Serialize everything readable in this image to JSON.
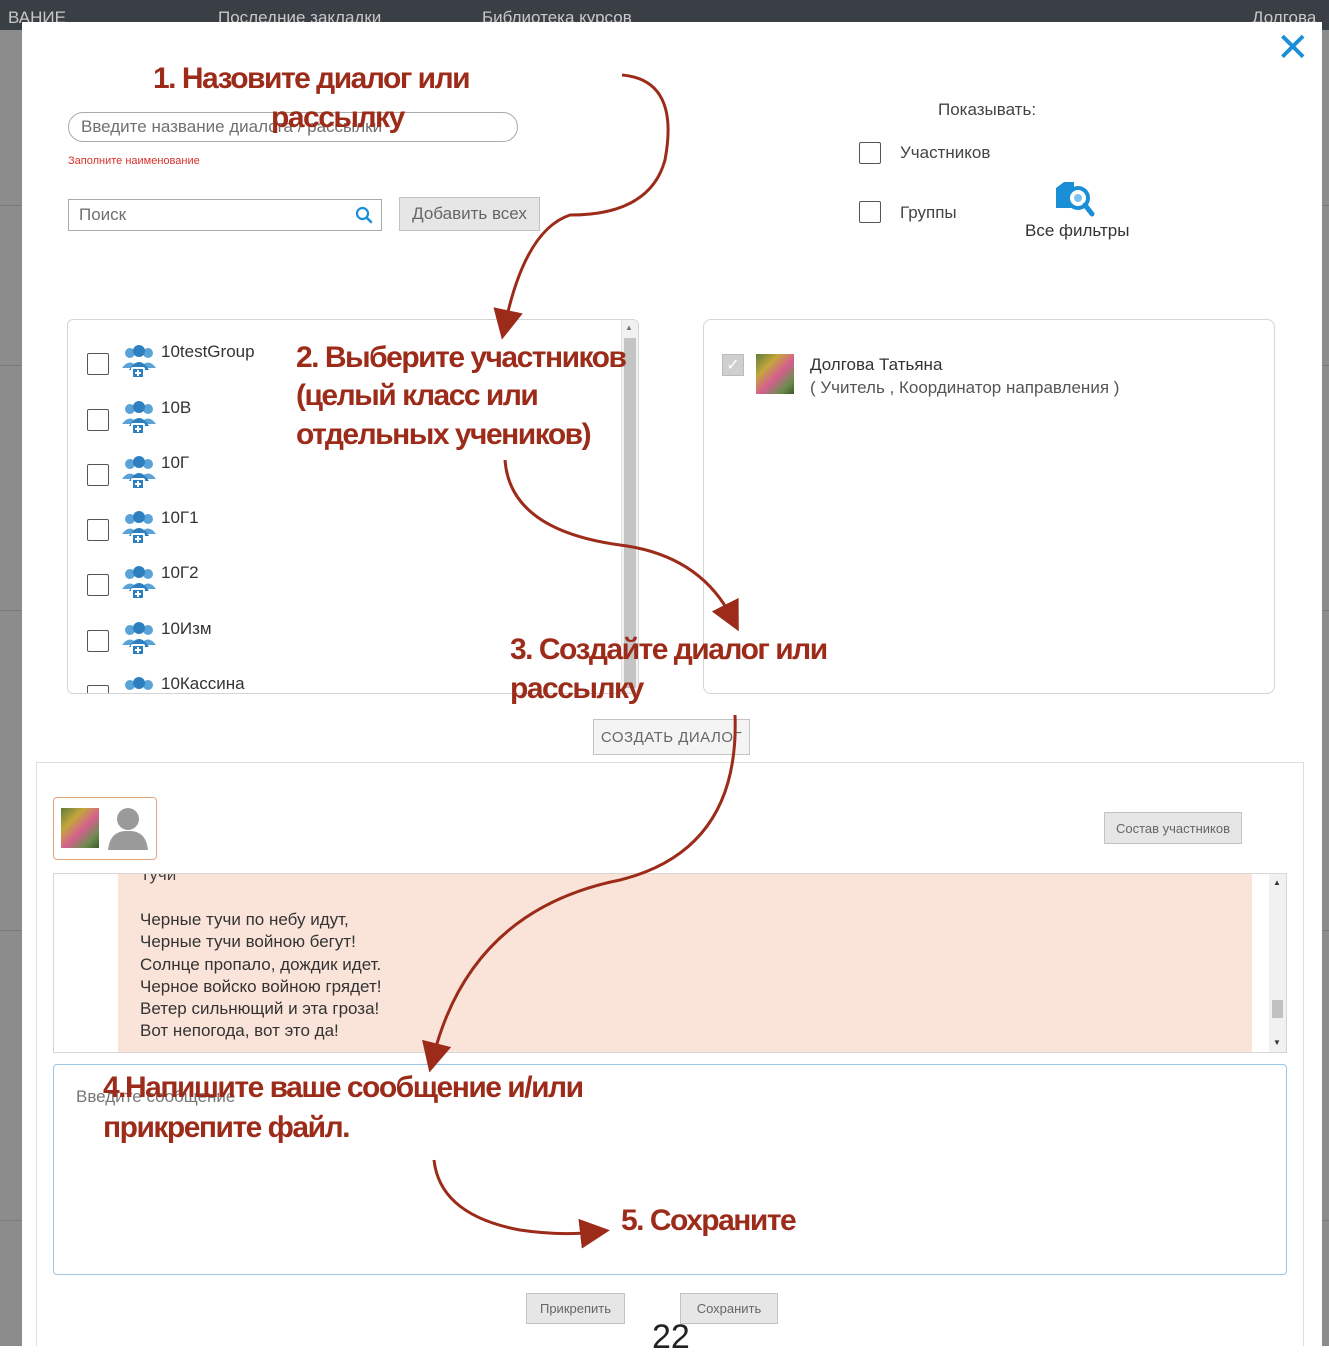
{
  "background": {
    "nav_item_1": "Последние закладки",
    "nav_item_2": "Библиотека курсов",
    "left_fragment": "ВАНИЕ",
    "user_fragment": "Долгова"
  },
  "dialog": {
    "close_icon": "close-icon",
    "name_placeholder": "Введите название диалога / рассылки",
    "name_error": "Заполните наименование",
    "search_placeholder": "Поиск",
    "add_all_label": "Добавить всех",
    "show_label": "Показывать:",
    "filter_participants_label": "Участников",
    "filter_groups_label": "Группы",
    "all_filters_label": "Все фильтры",
    "groups": [
      {
        "label": "10testGroup"
      },
      {
        "label": "10В"
      },
      {
        "label": "10Г"
      },
      {
        "label": "10Г1"
      },
      {
        "label": "10Г2"
      },
      {
        "label": "10Изм"
      },
      {
        "label": "10Кассина"
      }
    ],
    "selected_member": {
      "name": "Долгова Татьяна",
      "role": "( Учитель , Координатор направления )"
    },
    "create_button": "СОЗДАТЬ ДИАЛОГ"
  },
  "chat": {
    "members_button": "Состав участников",
    "message": {
      "title": "Тучи",
      "lines": [
        "Черные тучи по небу идут,",
        "Черные тучи войною бегут!",
        "Солнце пропало, дождик идет.",
        "Черное войско войною грядет!",
        "Ветер сильнющий и эта гроза!",
        "Вот непогода, вот это да!"
      ]
    },
    "input_placeholder": "Введите сообщение",
    "attach_button": "Прикрепить",
    "save_button": "Сохранить"
  },
  "annotations": {
    "step1_line1": "1. Назовите диалог или",
    "step1_line2": "рассылку",
    "step2_line1": "2. Выберите участников",
    "step2_line2": "(целый класс или",
    "step2_line3": "отдельных учеников)",
    "step3_line1": "3. Создайте диалог или",
    "step3_line2": "рассылку",
    "step4_line1": "4.Напишите ваше сообщение и/или",
    "step4_line2": "прикрепите файл.",
    "step5": "5. Сохраните",
    "annotation_color": "#9c2b1a"
  },
  "page_number": "22"
}
